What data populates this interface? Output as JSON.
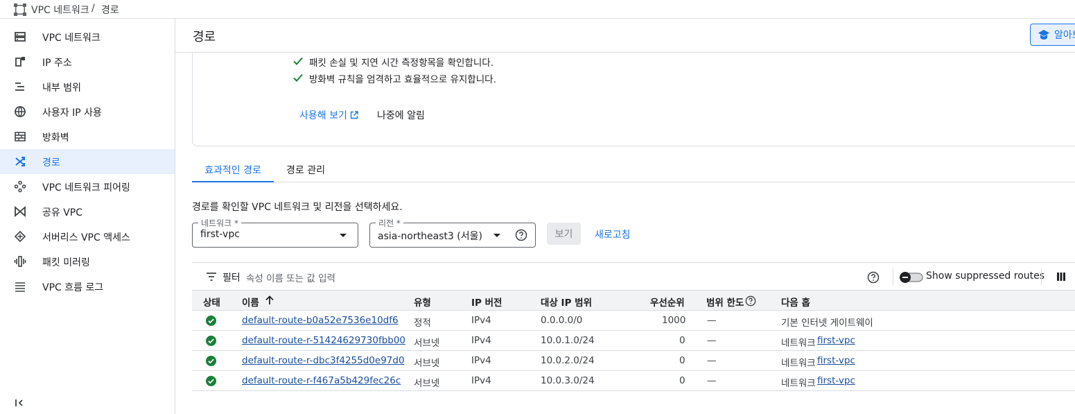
{
  "breadcrumb": {
    "product": "VPC 네트워크",
    "separator": "/",
    "current": "경로"
  },
  "sidebar": {
    "items": [
      {
        "label": "VPC 네트워크",
        "icon": "vpc-network-icon",
        "active": false
      },
      {
        "label": "IP 주소",
        "icon": "ip-address-icon",
        "active": false
      },
      {
        "label": "내부 범위",
        "icon": "internal-range-icon",
        "active": false
      },
      {
        "label": "사용자 IP 사용",
        "icon": "globe-icon",
        "active": false
      },
      {
        "label": "방화벽",
        "icon": "firewall-icon",
        "active": false
      },
      {
        "label": "경로",
        "icon": "routes-icon",
        "active": true
      },
      {
        "label": "VPC 네트워크 피어링",
        "icon": "peering-icon",
        "active": false
      },
      {
        "label": "공유 VPC",
        "icon": "shared-vpc-icon",
        "active": false
      },
      {
        "label": "서버리스 VPC 액세스",
        "icon": "serverless-icon",
        "active": false
      },
      {
        "label": "패킷 미러링",
        "icon": "packet-mirroring-icon",
        "active": false
      },
      {
        "label": "VPC 흐름 로그",
        "icon": "flow-logs-icon",
        "active": false
      }
    ]
  },
  "header": {
    "title": "경로",
    "learn_button": "알아보"
  },
  "promo": {
    "checks": [
      "패킷 손실 및 지연 시간 측정항목을 확인합니다.",
      "방화벽 규칙을 엄격하고 효율적으로 유지합니다."
    ],
    "try_link": "사용해 보기",
    "later_link": "나중에 알림"
  },
  "tabs": [
    {
      "label": "효과적인 경로",
      "active": true
    },
    {
      "label": "경로 관리",
      "active": false
    }
  ],
  "instruction": "경로를 확인할 VPC 네트워크 및 리전을 선택하세요.",
  "network_select": {
    "label": "네트워크 *",
    "value": "first-vpc"
  },
  "region_select": {
    "label": "리전 *",
    "value": "asia-northeast3 (서울)"
  },
  "view_button": "보기",
  "refresh_button": "새로고침",
  "filter": {
    "label": "필터",
    "placeholder": "속성 이름 또는 값 입력"
  },
  "toggle": {
    "label": "Show suppressed routes",
    "on": false
  },
  "table": {
    "columns": [
      "상태",
      "이름",
      "유형",
      "IP 버전",
      "대상 IP 범위",
      "우선순위",
      "범위 한도",
      "다음 홉"
    ],
    "rows": [
      {
        "status": "ok",
        "name": "default-route-b0a52e7536e10df6",
        "type": "정적",
        "ip_version": "IPv4",
        "dest_range": "0.0.0.0/0",
        "priority": "1000",
        "scope": "—",
        "next_hop": "기본 인터넷 게이트웨이",
        "next_hop_link": ""
      },
      {
        "status": "ok",
        "name": "default-route-r-51424629730fbb00",
        "type": "서브넷",
        "ip_version": "IPv4",
        "dest_range": "10.0.1.0/24",
        "priority": "0",
        "scope": "—",
        "next_hop": "네트워크",
        "next_hop_link": "first-vpc"
      },
      {
        "status": "ok",
        "name": "default-route-r-dbc3f4255d0e97d0",
        "type": "서브넷",
        "ip_version": "IPv4",
        "dest_range": "10.0.2.0/24",
        "priority": "0",
        "scope": "—",
        "next_hop": "네트워크",
        "next_hop_link": "first-vpc"
      },
      {
        "status": "ok",
        "name": "default-route-r-f467a5b429fec26c",
        "type": "서브넷",
        "ip_version": "IPv4",
        "dest_range": "10.0.3.0/24",
        "priority": "0",
        "scope": "—",
        "next_hop": "네트워크",
        "next_hop_link": "first-vpc"
      }
    ]
  },
  "colors": {
    "accent": "#1a73e8",
    "status_ok": "#188038",
    "active_bg": "#e8f0fe"
  }
}
